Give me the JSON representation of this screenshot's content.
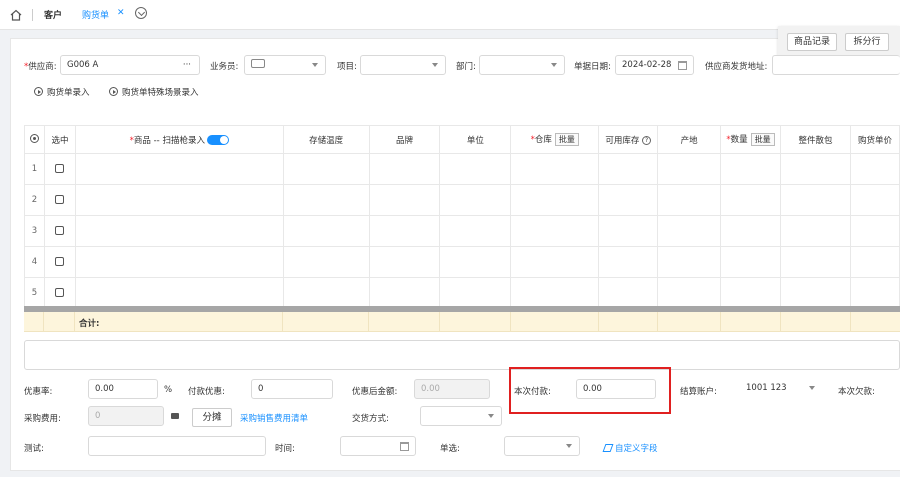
{
  "tabs": {
    "customer": "客户",
    "purchase": "购货单",
    "close": "✕"
  },
  "top_buttons": {
    "product_record": "商品记录",
    "split_row": "拆分行"
  },
  "header": {
    "supplier_label": "供应商:",
    "supplier_value": "G006 A",
    "supplier_more": "···",
    "salesman_label": "业务员:",
    "project_label": "项目:",
    "dept_label": "部门:",
    "date_label": "单据日期:",
    "date_value": "2024-02-28",
    "address_label": "供应商发货地址:"
  },
  "entry_links": {
    "purchase_entry": "购货单录入",
    "special_entry": "购货单特殊场景录入"
  },
  "grid": {
    "columns": [
      "选中",
      "商品 -- 扫描枪录入",
      "存储温度",
      "品牌",
      "单位",
      "仓库",
      "批量",
      "可用库存",
      "产地",
      "数量",
      "批量",
      "整件散包",
      "购货单价"
    ],
    "row_numbers": [
      "1",
      "2",
      "3",
      "4",
      "5"
    ],
    "total_label": "合计:"
  },
  "footer": {
    "discount_rate_label": "优惠率:",
    "discount_rate_value": "0.00",
    "percent": "%",
    "pay_discount_label": "付款优惠:",
    "pay_discount_value": "0",
    "after_discount_label": "优惠后金额:",
    "after_discount_value": "0.00",
    "this_payment_label": "本次付款:",
    "this_payment_value": "0.00",
    "settle_account_label": "结算账户:",
    "settle_account_value": "1001 123",
    "this_debt_label": "本次欠款:",
    "purchase_fee_label": "采购费用:",
    "purchase_fee_value": "0",
    "split_button": "分摊",
    "fee_list_link": "采购销售费用清单",
    "delivery_label": "交货方式:",
    "test_label": "测试:",
    "time_label": "时间:",
    "single_select_label": "单选:",
    "custom_field_link": "自定义字段"
  },
  "colors": {
    "accent": "#1890ff",
    "highlight_box": "#e02020",
    "total_row": "#fdf5dc"
  }
}
